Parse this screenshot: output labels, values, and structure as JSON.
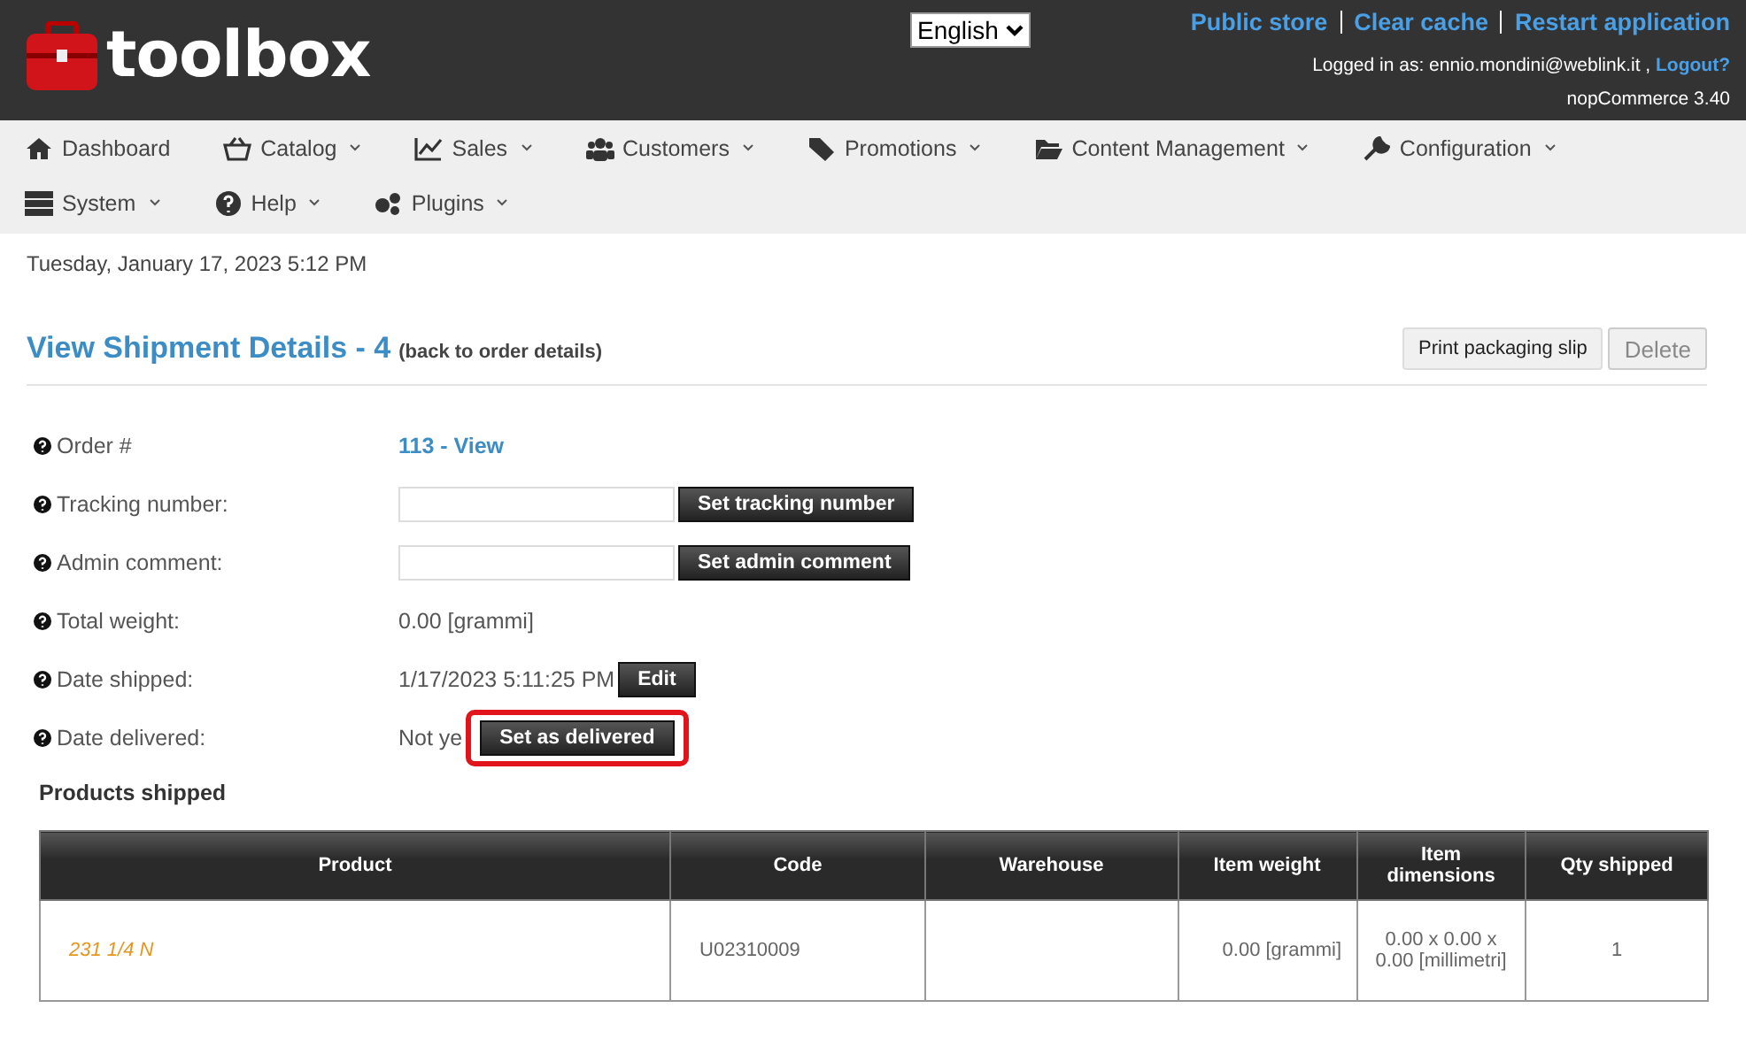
{
  "header": {
    "logo": "toolbox",
    "language": "English",
    "links": [
      "Public store",
      "Clear cache",
      "Restart application"
    ],
    "logged_in_label": "Logged in as: ennio.mondini@weblink.it ,",
    "logout": "Logout?",
    "version": "nopCommerce 3.40"
  },
  "nav": [
    {
      "label": "Dashboard",
      "dropdown": false
    },
    {
      "label": "Catalog",
      "dropdown": true
    },
    {
      "label": "Sales",
      "dropdown": true
    },
    {
      "label": "Customers",
      "dropdown": true
    },
    {
      "label": "Promotions",
      "dropdown": true
    },
    {
      "label": "Content Management",
      "dropdown": true
    },
    {
      "label": "Configuration",
      "dropdown": true
    },
    {
      "label": "System",
      "dropdown": true
    },
    {
      "label": "Help",
      "dropdown": true
    },
    {
      "label": "Plugins",
      "dropdown": true
    }
  ],
  "date": "Tuesday, January 17, 2023 5:12 PM",
  "title": "View Shipment Details - 4",
  "back_link": "(back to order details)",
  "actions": [
    "Print packaging slip",
    "Delete"
  ],
  "fields": [
    {
      "kind": "link",
      "label": "Order #",
      "value": "113 - View"
    },
    {
      "kind": "input",
      "label": "Tracking number:",
      "button": "Set tracking number"
    },
    {
      "kind": "input",
      "label": "Admin comment:",
      "button": "Set admin comment"
    },
    {
      "kind": "text",
      "label": "Total weight:",
      "value": "0.00 [grammi]"
    },
    {
      "kind": "text_button",
      "label": "Date shipped:",
      "value": "1/17/2023 5:11:25 PM",
      "button": "Edit"
    },
    {
      "kind": "text_button",
      "label": "Date delivered:",
      "value": "Not ye",
      "button": "Set as delivered",
      "highlighted": true
    }
  ],
  "products_title": "Products shipped",
  "table": {
    "columns": [
      "Product",
      "Code",
      "Warehouse",
      "Item weight",
      "Item dimensions",
      "Qty shipped"
    ],
    "rows": [
      [
        "231 1/4 N",
        "U02310009",
        "",
        "0.00 [grammi]",
        "0.00 x 0.00 x 0.00 [millimetri]",
        "1"
      ]
    ]
  }
}
